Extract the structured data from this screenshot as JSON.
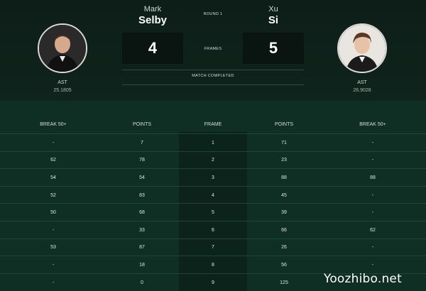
{
  "match": {
    "round": "ROUND 1",
    "frames_label": "FRAMES",
    "status": "MATCH COMPLETED"
  },
  "player_left": {
    "first_name": "Mark",
    "last_name": "Selby",
    "score": "4",
    "label": "AST",
    "ast_value": "25.1805"
  },
  "player_right": {
    "first_name": "Xu",
    "last_name": "Si",
    "score": "5",
    "label": "AST",
    "ast_value": "26.9028"
  },
  "table": {
    "headers": [
      "BREAK 50+",
      "POINTS",
      "FRAME",
      "POINTS",
      "BREAK 50+"
    ],
    "rows": [
      [
        "-",
        "7",
        "1",
        "71",
        "-"
      ],
      [
        "62",
        "78",
        "2",
        "23",
        "-"
      ],
      [
        "54",
        "54",
        "3",
        "88",
        "88"
      ],
      [
        "52",
        "83",
        "4",
        "45",
        "-"
      ],
      [
        "50",
        "68",
        "5",
        "39",
        "-"
      ],
      [
        "-",
        "33",
        "6",
        "66",
        "62"
      ],
      [
        "53",
        "87",
        "7",
        "26",
        "-"
      ],
      [
        "-",
        "18",
        "8",
        "56",
        "-"
      ],
      [
        "-",
        "0",
        "9",
        "125",
        "-"
      ]
    ]
  },
  "watermark": "Yoozhibo.net"
}
